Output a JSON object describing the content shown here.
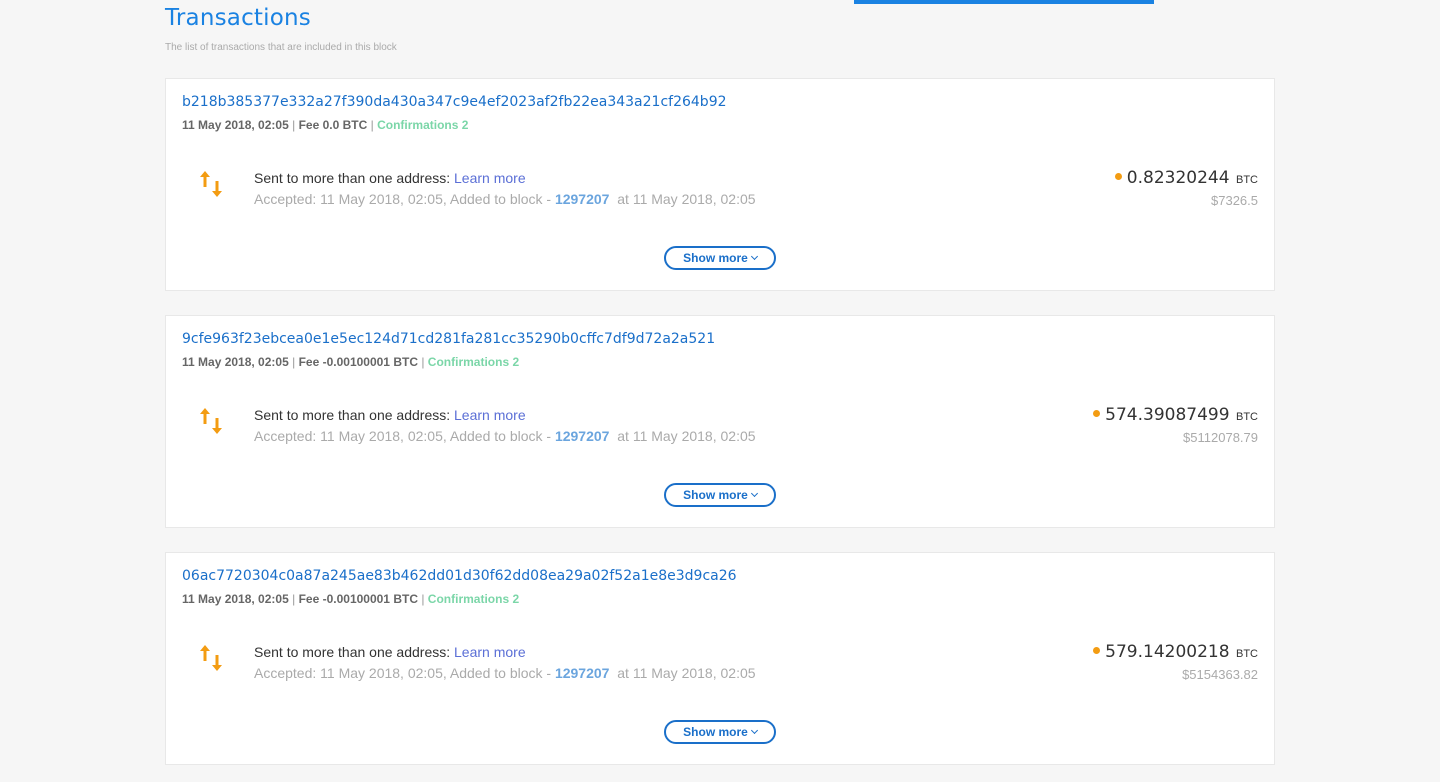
{
  "header": {
    "title": "Transactions",
    "subtitle": "The list of transactions that are included in this block"
  },
  "transactions": [
    {
      "hash": "b218b385377e332a27f390da430a347c9e4ef2023af2fb22ea343a21cf264b92",
      "date": "11 May 2018, 02:05",
      "fee": "Fee 0.0 BTC",
      "confirmations": "Confirmations 2",
      "sent_text": "Sent to more than one address:",
      "learn_more": "Learn more",
      "accepted_prefix": "Accepted: 11 May 2018, 02:05, Added to block -",
      "block": "1297207",
      "accepted_suffix": "at 11 May 2018, 02:05",
      "amount": "0.82320244",
      "unit": "BTC",
      "usd": "$7326.5",
      "show_more": "Show more"
    },
    {
      "hash": "9cfe963f23ebcea0e1e5ec124d71cd281fa281cc35290b0cffc7df9d72a2a521",
      "date": "11 May 2018, 02:05",
      "fee": "Fee -0.00100001 BTC",
      "confirmations": "Confirmations 2",
      "sent_text": "Sent to more than one address:",
      "learn_more": "Learn more",
      "accepted_prefix": "Accepted: 11 May 2018, 02:05, Added to block -",
      "block": "1297207",
      "accepted_suffix": "at 11 May 2018, 02:05",
      "amount": "574.39087499",
      "unit": "BTC",
      "usd": "$5112078.79",
      "show_more": "Show more"
    },
    {
      "hash": "06ac7720304c0a87a245ae83b462dd01d30f62dd08ea29a02f52a1e8e3d9ca26",
      "date": "11 May 2018, 02:05",
      "fee": "Fee -0.00100001 BTC",
      "confirmations": "Confirmations 2",
      "sent_text": "Sent to more than one address:",
      "learn_more": "Learn more",
      "accepted_prefix": "Accepted: 11 May 2018, 02:05, Added to block -",
      "block": "1297207",
      "accepted_suffix": "at 11 May 2018, 02:05",
      "amount": "579.14200218",
      "unit": "BTC",
      "usd": "$5154363.82",
      "show_more": "Show more"
    }
  ],
  "icons": {
    "transfer": "transfer-arrows-icon",
    "amount_dot": "status-dot-icon",
    "chevron": "chevron-down-icon"
  },
  "colors": {
    "accent": "#1a82e2",
    "link": "#1a6fc9",
    "confirm": "#7bd6a8",
    "arrow": "#f39c12"
  }
}
